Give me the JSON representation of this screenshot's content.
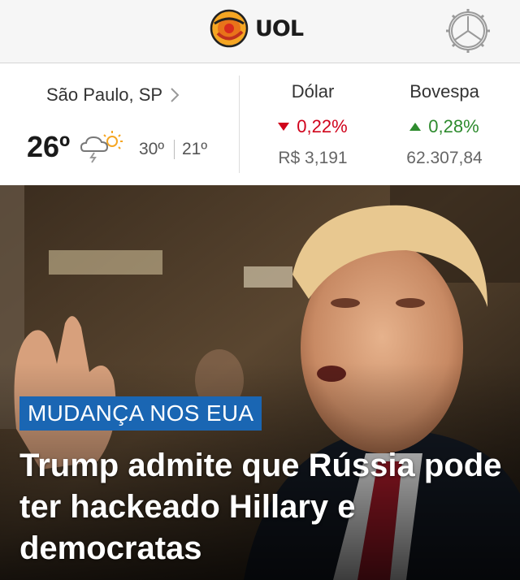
{
  "header": {
    "brand": "UOL",
    "icons": {
      "logo": "uol-logo-icon",
      "settings": "settings-gear-icon"
    }
  },
  "weather": {
    "location": "São Paulo, SP",
    "current_temp": "26º",
    "max_temp": "30º",
    "min_temp": "21º",
    "icon": "cloud-sun-thunder-icon"
  },
  "markets": [
    {
      "name": "Dólar",
      "change": "0,22%",
      "direction": "down",
      "value": "R$ 3,191",
      "color": "#d0021b"
    },
    {
      "name": "Bovespa",
      "change": "0,28%",
      "direction": "up",
      "value": "62.307,84",
      "color": "#2e8b2e"
    }
  ],
  "featured": {
    "tag": "MUDANÇA NOS EUA",
    "headline": "Trump admite que Rússia pode ter hackeado Hillary e democratas",
    "tag_color": "#1a66b3"
  }
}
